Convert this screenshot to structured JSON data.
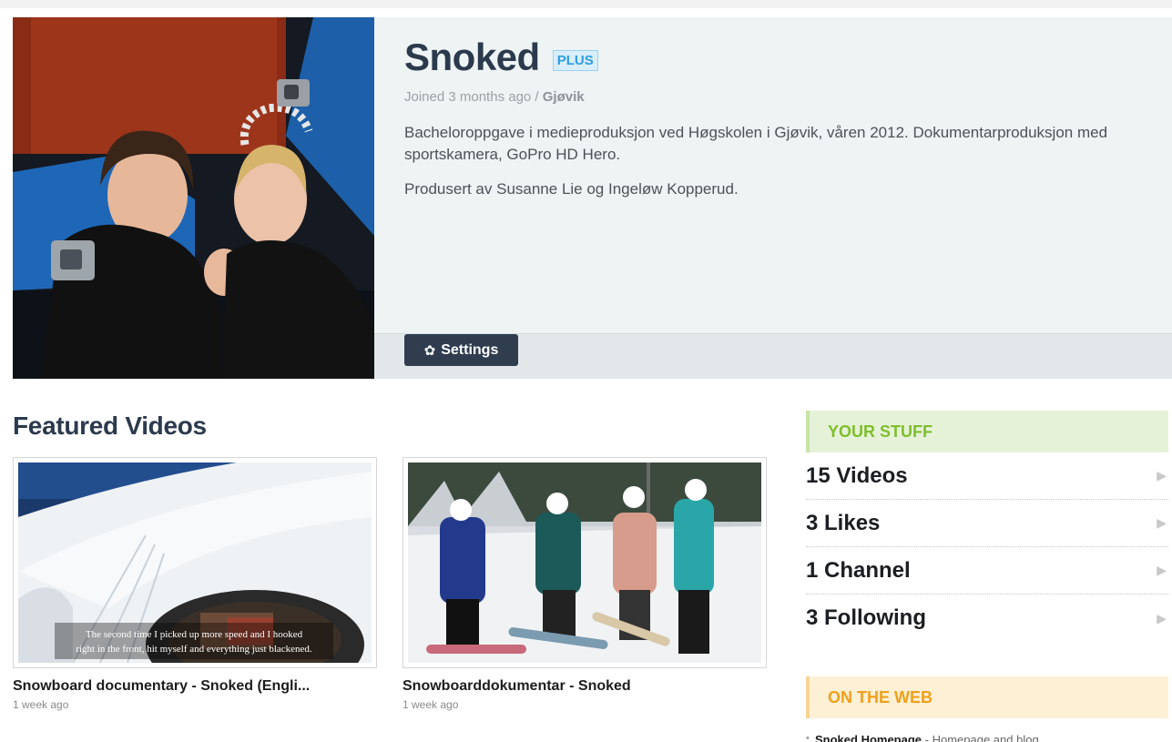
{
  "profile": {
    "name": "Snoked",
    "badge": "PLUS",
    "joined_prefix": "Joined 3 months ago / ",
    "location": "Gjøvik",
    "bio": [
      "Bacheloroppgave i medieproduksjon ved Høgskolen i Gjøvik, våren 2012. Dokumentarproduksjon med sportskamera, GoPro HD Hero.",
      "Produsert av Susanne Lie og Ingeløw Kopperud."
    ],
    "settings_label": "Settings",
    "settings_icon": "gear-icon"
  },
  "featured": {
    "title": "Featured Videos",
    "videos": [
      {
        "title": "Snowboard documentary - Snoked (Engli...",
        "date": "1 week ago",
        "subtitle_line1": "The second time I picked up more speed and I hooked",
        "subtitle_line2": "right in the front, hit myself and everything just blackened."
      },
      {
        "title": "Snowboarddokumentar - Snoked",
        "date": "1 week ago"
      }
    ]
  },
  "sidebar": {
    "stuff_title": "YOUR STUFF",
    "stats": [
      {
        "label": "15 Videos"
      },
      {
        "label": "3 Likes"
      },
      {
        "label": "1 Channel"
      },
      {
        "label": "3 Following"
      }
    ],
    "arrow_icon": "arrow-right-icon",
    "web_title": "ON THE WEB",
    "links": [
      {
        "name": "Snoked Homepage",
        "desc": " - Homepage and blog"
      }
    ]
  },
  "colors": {
    "name": "#2c3a4d",
    "plus_badge": "#2e9de2",
    "stuff_accent": "#7fbf2d",
    "web_accent": "#f0a01c",
    "settings_button": "#2f3d4f"
  }
}
